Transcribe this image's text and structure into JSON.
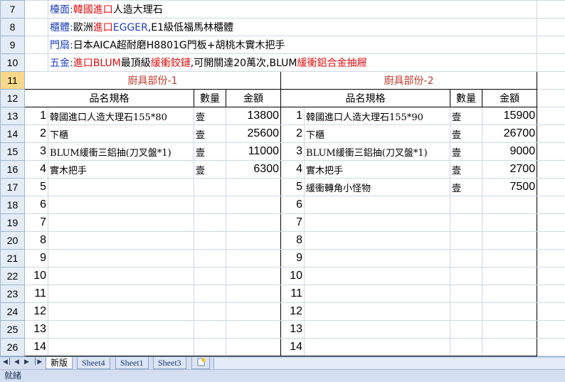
{
  "rows": {
    "r7": "7",
    "r8": "8",
    "r9": "9",
    "r10": "10",
    "r11": "11",
    "r12": "12",
    "r13": "13",
    "r14": "14",
    "r15": "15",
    "r16": "16",
    "r17": "17",
    "r18": "18",
    "r19": "19",
    "r20": "20",
    "r21": "21",
    "r22": "22",
    "r23": "23",
    "r24": "24",
    "r25": "25",
    "r26": "26"
  },
  "info": {
    "countertop_label": "檯面:",
    "countertop_red": "韓國進口",
    "countertop_rest": "人造大理石",
    "cabinet_label": "櫃體:",
    "cabinet_pre": "歐洲",
    "cabinet_red": "進口",
    "cabinet_blue": "EGGER",
    "cabinet_rest": ",E1級低福馬林櫃體",
    "door_label": "門扇:",
    "door_rest": "日本AICA超耐磨H8801G門板+胡桃木實木把手",
    "hardware_label": "五金:",
    "hardware_red1": "進口BLUM",
    "hardware_mid1": "最頂級",
    "hardware_red2": "緩衝鉸鏈",
    "hardware_mid2": ",可開關達20萬次,BLUM",
    "hardware_red3": "緩衝鋁合金抽屜"
  },
  "section1": {
    "title": "廚具部份-1",
    "col_name": "品名規格",
    "col_qty": "數量",
    "col_amount": "金額",
    "items": [
      {
        "no": "1",
        "name": "韓國進口人造大理石155*80",
        "qty": "壹",
        "amount": "13800"
      },
      {
        "no": "2",
        "name": "下櫃",
        "qty": "壹",
        "amount": "25600"
      },
      {
        "no": "3",
        "name": "BLUM緩衝三鋁抽(刀叉盤*1)",
        "qty": "壹",
        "amount": "11000"
      },
      {
        "no": "4",
        "name": "實木把手",
        "qty": "壹",
        "amount": "6300"
      },
      {
        "no": "5"
      },
      {
        "no": "6"
      },
      {
        "no": "7"
      },
      {
        "no": "8"
      },
      {
        "no": "9"
      },
      {
        "no": "10"
      },
      {
        "no": "11"
      },
      {
        "no": "12"
      },
      {
        "no": "13"
      },
      {
        "no": "14"
      }
    ]
  },
  "section2": {
    "title": "廚具部份-2",
    "col_name": "品名規格",
    "col_qty": "數量",
    "col_amount": "金額",
    "items": [
      {
        "no": "1",
        "name": "韓國進口人造大理石155*90",
        "qty": "壹",
        "amount": "15900"
      },
      {
        "no": "2",
        "name": "下櫃",
        "qty": "壹",
        "amount": "26700"
      },
      {
        "no": "3",
        "name": "BLUM緩衝三鋁抽(刀叉盤*1)",
        "qty": "壹",
        "amount": "9000"
      },
      {
        "no": "4",
        "name": "實木把手",
        "qty": "壹",
        "amount": "2700"
      },
      {
        "no": "5",
        "name": "緩衝轉角小怪物",
        "qty": "壹",
        "amount": "7500"
      },
      {
        "no": "6"
      },
      {
        "no": "7"
      },
      {
        "no": "8"
      },
      {
        "no": "9"
      },
      {
        "no": "10"
      },
      {
        "no": "11"
      },
      {
        "no": "12"
      },
      {
        "no": "13"
      },
      {
        "no": "14"
      }
    ]
  },
  "tabs": [
    "新版",
    "Sheet4",
    "Sheet1",
    "Sheet3"
  ],
  "status": "就緒"
}
